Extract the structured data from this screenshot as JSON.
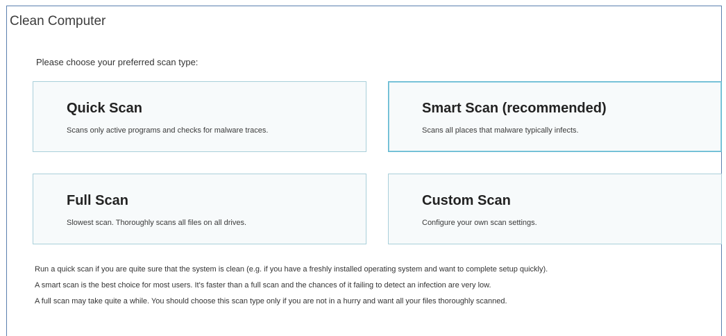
{
  "window": {
    "title": "Clean Computer"
  },
  "prompt": "Please choose your preferred scan type:",
  "scan_options": [
    {
      "title": "Quick Scan",
      "description": "Scans only active programs and checks for malware traces.",
      "selected": false
    },
    {
      "title": "Smart Scan (recommended)",
      "description": "Scans all places that malware typically infects.",
      "selected": true
    },
    {
      "title": "Full Scan",
      "description": "Slowest scan. Thoroughly scans all files on all drives.",
      "selected": false
    },
    {
      "title": "Custom Scan",
      "description": "Configure your own scan settings.",
      "selected": false
    }
  ],
  "notes": [
    "Run a quick scan if you are quite sure that the system is clean (e.g. if you have a freshly installed operating system and want to complete setup quickly).",
    "A smart scan is the best choice for most users. It's faster than a full scan and the chances of it failing to detect an infection are very low.",
    "A full scan may take quite a while. You should choose this scan type only if you are not in a hurry and want all your files thoroughly scanned."
  ],
  "colors": {
    "panel_border": "#5a7fae",
    "card_border": "#a9cfda",
    "card_selected_border": "#5fb6cf",
    "card_background": "#f7fafb"
  }
}
